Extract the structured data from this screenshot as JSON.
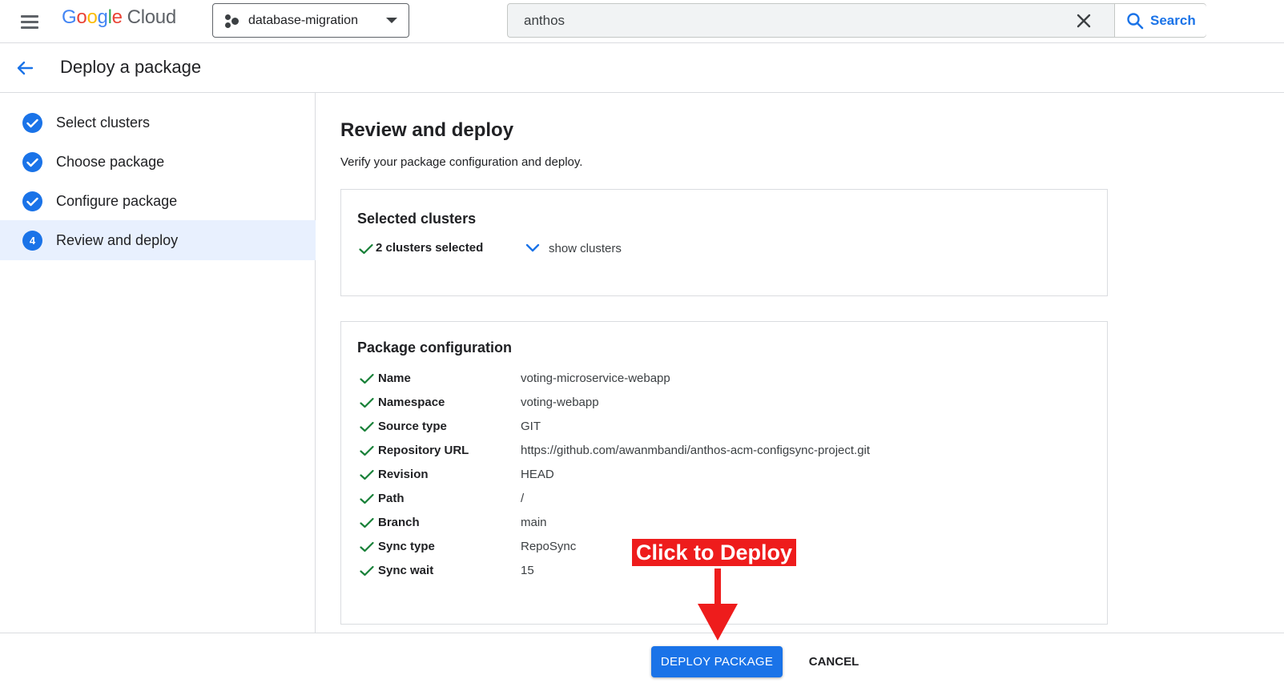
{
  "topbar": {
    "logo_google": "Google",
    "logo_cloud": "Cloud",
    "project_name": "database-migration",
    "search_value": "anthos",
    "search_label": "Search"
  },
  "page": {
    "title": "Deploy a package"
  },
  "steps": [
    {
      "label": "Select clusters",
      "state": "complete"
    },
    {
      "label": "Choose package",
      "state": "complete"
    },
    {
      "label": "Configure package",
      "state": "complete"
    },
    {
      "label": "Review and deploy",
      "state": "active",
      "number": "4"
    }
  ],
  "review": {
    "title": "Review and deploy",
    "subtitle": "Verify your package configuration and deploy.",
    "clusters_card": {
      "title": "Selected clusters",
      "count_text": "2 clusters selected",
      "show_label": "show clusters"
    },
    "config_card": {
      "title": "Package configuration",
      "rows": [
        {
          "key": "Name",
          "value": "voting-microservice-webapp"
        },
        {
          "key": "Namespace",
          "value": "voting-webapp"
        },
        {
          "key": "Source type",
          "value": "GIT"
        },
        {
          "key": "Repository URL",
          "value": "https://github.com/awanmbandi/anthos-acm-configsync-project.git"
        },
        {
          "key": "Revision",
          "value": "HEAD"
        },
        {
          "key": "Path",
          "value": "/"
        },
        {
          "key": "Branch",
          "value": "main"
        },
        {
          "key": "Sync type",
          "value": "RepoSync"
        },
        {
          "key": "Sync wait",
          "value": "15"
        }
      ]
    }
  },
  "footer": {
    "deploy_label": "DEPLOY PACKAGE",
    "cancel_label": "CANCEL"
  },
  "annotation": {
    "text": "Click to Deploy"
  },
  "colors": {
    "primary": "#1a73e8",
    "check": "#188038",
    "annotation": "#ee1c1c"
  },
  "icons": [
    "menu-icon",
    "project-icon",
    "chevron-down-icon",
    "close-icon",
    "search-icon",
    "back-arrow-icon",
    "check-circle-icon",
    "check-icon",
    "expand-more-icon",
    "arrow-down-icon"
  ]
}
